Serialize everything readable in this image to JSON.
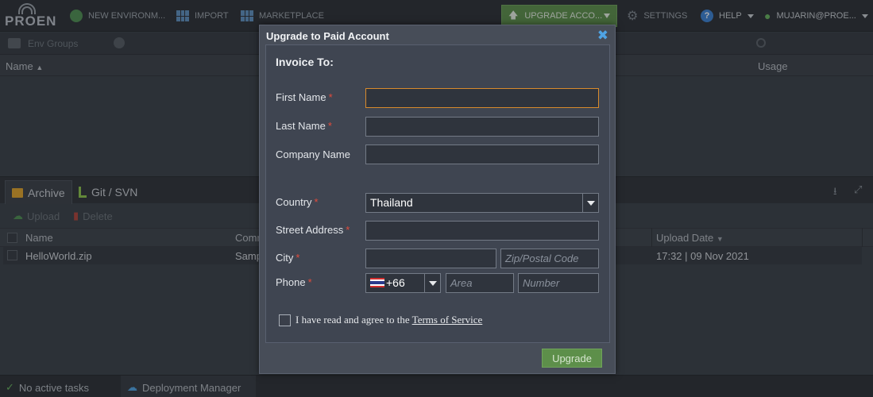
{
  "brand": {
    "logo_text": "PROEN"
  },
  "topbar": {
    "new_env": "NEW ENVIRONM...",
    "import": "IMPORT",
    "marketplace": "MARKETPLACE",
    "upgrade": "UPGRADE ACCO...",
    "settings": "SETTINGS",
    "help": "HELP",
    "user": "MUJARIN@PROE..."
  },
  "env_panel": {
    "groups_label": "Env Groups",
    "col_name": "Name",
    "col_usage": "Usage"
  },
  "bottom_panel": {
    "tabs": [
      {
        "label": "Archive"
      },
      {
        "label": "Git / SVN"
      }
    ],
    "upload": "Upload",
    "delete": "Delete",
    "columns": {
      "name": "Name",
      "comment": "Comm",
      "upload_date": "Upload Date"
    },
    "rows": [
      {
        "name": "HelloWorld.zip",
        "comment": "Samp",
        "upload_date": "17:32 | 09 Nov 2021"
      }
    ]
  },
  "statusbar": {
    "tasks": "No active tasks",
    "deployment": "Deployment Manager"
  },
  "dialog": {
    "title": "Upgrade to Paid Account",
    "section": "Invoice To:",
    "labels": {
      "first_name": "First Name",
      "last_name": "Last Name",
      "company": "Company Name",
      "country": "Country",
      "street": "Street Address",
      "city": "City",
      "phone": "Phone"
    },
    "required_mark": "*",
    "values": {
      "first_name": "",
      "last_name": "",
      "company": "",
      "country": "Thailand",
      "street": "",
      "city": "",
      "phone_code": "+66"
    },
    "placeholders": {
      "zip": "Zip/Postal Code",
      "area": "Area",
      "number": "Number"
    },
    "agree_text": "I have read and agree to the ",
    "terms_link": "Terms of Service",
    "submit": "Upgrade"
  },
  "colors": {
    "accent_green": "#5d8f4a",
    "focus_orange": "#d88a2c",
    "required_red": "#e24b3c",
    "close_blue": "#4fa3e3"
  }
}
